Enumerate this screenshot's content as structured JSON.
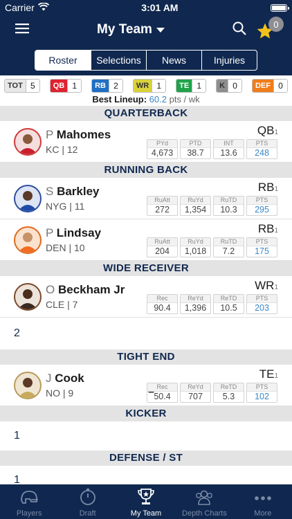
{
  "status": {
    "carrier": "Carrier",
    "time": "3:01 AM"
  },
  "nav": {
    "title": "My Team",
    "star_count": "0"
  },
  "tabs": [
    "Roster",
    "Selections",
    "News",
    "Injuries"
  ],
  "counts": [
    {
      "tag": "TOT",
      "num": "5",
      "color": "#e8e8e8",
      "text": "#333"
    },
    {
      "tag": "QB",
      "num": "1",
      "color": "#e0212e",
      "text": "#fff"
    },
    {
      "tag": "RB",
      "num": "2",
      "color": "#1f6fc4",
      "text": "#fff"
    },
    {
      "tag": "WR",
      "num": "1",
      "color": "#d9d23a",
      "text": "#333"
    },
    {
      "tag": "TE",
      "num": "1",
      "color": "#20a24a",
      "text": "#fff"
    },
    {
      "tag": "K",
      "num": "0",
      "color": "#8e8e8e",
      "text": "#333"
    },
    {
      "tag": "DEF",
      "num": "0",
      "color": "#f07d1a",
      "text": "#fff"
    }
  ],
  "best": {
    "label": "Best Lineup:",
    "value": "60.2",
    "unit": "pts / wk"
  },
  "sections": {
    "qb": "QUARTERBACK",
    "rb": "RUNNING BACK",
    "wr": "WIDE RECEIVER",
    "te": "TIGHT END",
    "k": "KICKER",
    "def": "DEFENSE / ST"
  },
  "players": {
    "mahomes": {
      "initial": "P",
      "last": "Mahomes",
      "team": "KC | 12",
      "pos": "QB",
      "rank": "1",
      "s1h": "PYd",
      "s1v": "4,673",
      "s2h": "PTD",
      "s2v": "38.7",
      "s3h": "INT",
      "s3v": "13.6",
      "s4h": "PTS",
      "s4v": "248"
    },
    "barkley": {
      "initial": "S",
      "last": "Barkley",
      "team": "NYG | 11",
      "pos": "RB",
      "rank": "1",
      "s1h": "RuAtt",
      "s1v": "272",
      "s2h": "RuYd",
      "s2v": "1,354",
      "s3h": "RuTD",
      "s3v": "10.3",
      "s4h": "PTS",
      "s4v": "295"
    },
    "lindsay": {
      "initial": "P",
      "last": "Lindsay",
      "team": "DEN | 10",
      "pos": "RB",
      "rank": "1",
      "s1h": "RuAtt",
      "s1v": "204",
      "s2h": "RuYd",
      "s2v": "1,018",
      "s3h": "RuTD",
      "s3v": "7.2",
      "s4h": "PTS",
      "s4v": "175"
    },
    "beckham": {
      "initial": "O",
      "last": "Beckham Jr",
      "team": "CLE | 7",
      "pos": "WR",
      "rank": "1",
      "s1h": "Rec",
      "s1v": "90.4",
      "s2h": "ReYd",
      "s2v": "1,396",
      "s3h": "ReTD",
      "s3v": "10.5",
      "s4h": "PTS",
      "s4v": "203"
    },
    "cook": {
      "initial": "J",
      "last": "Cook",
      "team": "NO | 9",
      "pos": "TE",
      "rank": "1",
      "s1h": "Rec",
      "s1v": "50.4",
      "s2h": "ReYd",
      "s2v": "707",
      "s3h": "ReTD",
      "s3v": "5.3",
      "s4h": "PTS",
      "s4v": "102"
    }
  },
  "empty": {
    "wr": "2",
    "k": "1",
    "def": "1"
  },
  "tabbar": [
    "Players",
    "Draft",
    "My Team",
    "Depth Charts",
    "More"
  ]
}
